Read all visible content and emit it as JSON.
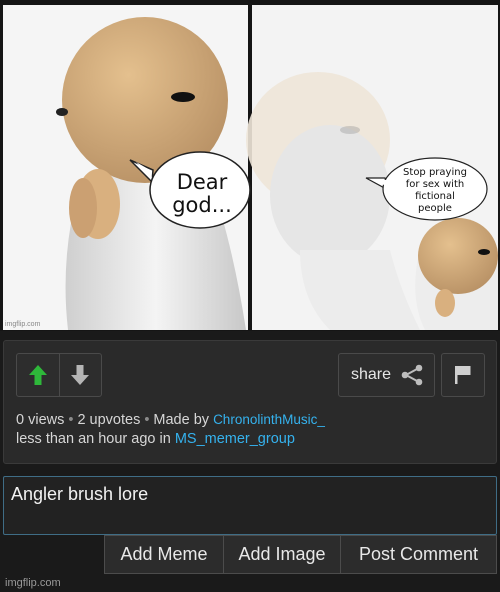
{
  "meme": {
    "bubble_left": [
      "Dear",
      "god..."
    ],
    "bubble_right": [
      "Stop praying",
      "for sex with",
      "fictional",
      "people"
    ],
    "watermark": "imgflip.com"
  },
  "actions": {
    "share_label": "share"
  },
  "meta": {
    "views": "0 views",
    "upvotes": "2 upvotes",
    "made_by_label": "Made by",
    "author": "ChronolinthMusic_",
    "time_prefix": "less than an hour ago in",
    "stream": "MS_memer_group"
  },
  "comment": {
    "value": "Angler brush lore"
  },
  "buttons": {
    "add_meme": "Add Meme",
    "add_image": "Add Image",
    "post_comment": "Post Comment"
  },
  "footer": {
    "watermark": "imgflip.com"
  },
  "colors": {
    "upvote_active": "#2eb83a",
    "link": "#35b2ee",
    "background": "#1a1a1a"
  }
}
